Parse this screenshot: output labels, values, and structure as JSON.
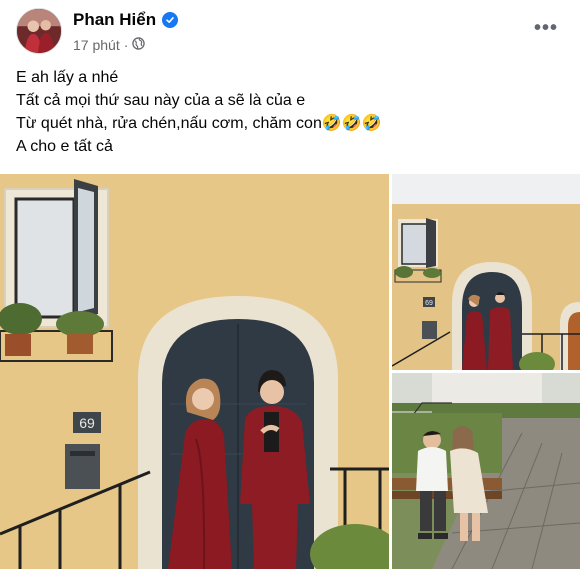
{
  "post": {
    "author": "Phan Hiển",
    "time": "17 phút",
    "separator": "·",
    "more_label": "•••",
    "caption_lines": [
      "E ah lấy a nhé",
      "Tất cả mọi thứ sau này của a sẽ là của e",
      "Từ quét nhà, rửa chén,nấu cơm, chăm con🤣🤣🤣",
      "A cho e tất cả"
    ]
  },
  "photos": {
    "house_number": "69",
    "house_number_small": "69"
  },
  "colors": {
    "verified": "#1877f2",
    "wall": "#e8c98b",
    "door": "#2f3a44",
    "dress": "#8b1a22"
  },
  "icons": [
    "verified-badge-icon",
    "globe-icon",
    "more-options-icon"
  ]
}
